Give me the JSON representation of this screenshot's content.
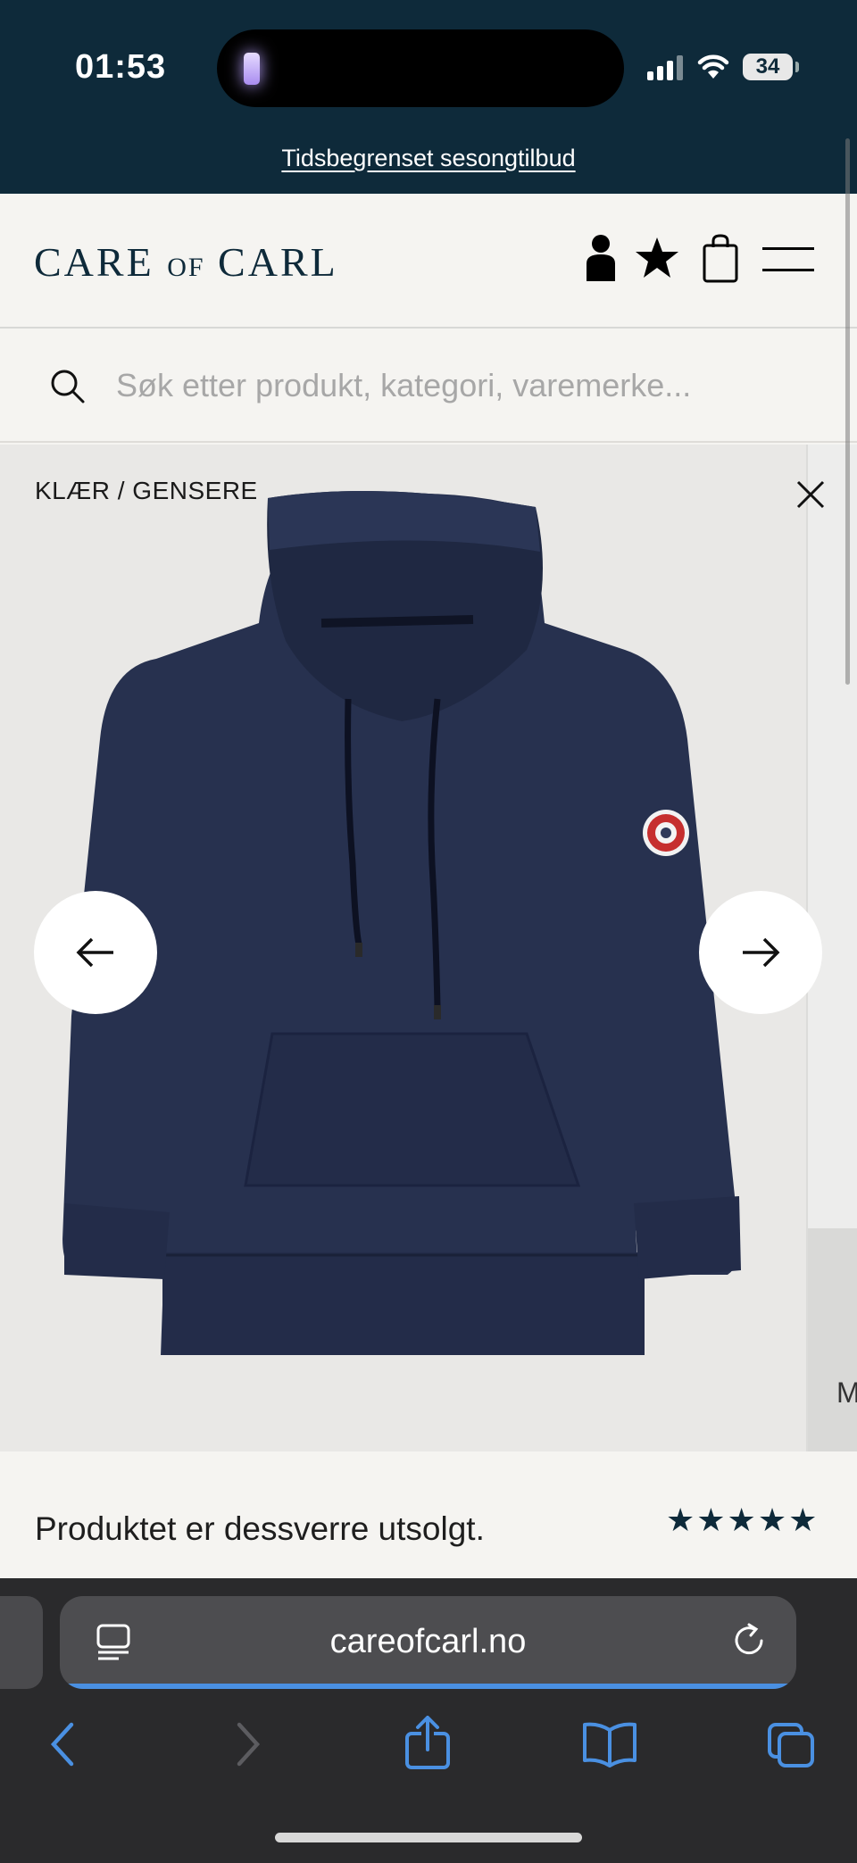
{
  "status_bar": {
    "time": "01:53",
    "battery": "34"
  },
  "promo": {
    "text": "Tidsbegrenset sesongtilbud"
  },
  "header": {
    "logo_main_1": "CARE",
    "logo_of": "OF",
    "logo_main_2": "CARL"
  },
  "search": {
    "placeholder": "Søk etter produkt, kategori, varemerke..."
  },
  "product": {
    "breadcrumb": "KLÆR / GENSERE",
    "next_slide_letter": "M",
    "soldout_text": "Produktet er dessverre utsolgt.",
    "rating": 5,
    "stars": "★★★★★"
  },
  "browser": {
    "url": "careofcarl.no"
  },
  "colors": {
    "navy": "#0e2a3a",
    "hoodie": "#27314f",
    "safari_blue": "#4a90e2"
  }
}
